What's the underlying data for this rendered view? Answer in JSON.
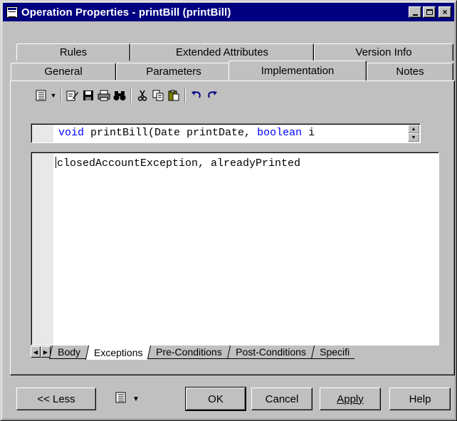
{
  "window": {
    "title": "Operation Properties - printBill (printBill)",
    "minimize": "_",
    "maximize": "□",
    "close": "×"
  },
  "tabs": {
    "row1": [
      "Rules",
      "Extended Attributes",
      "Version Info"
    ],
    "row2": [
      "General",
      "Parameters",
      "Implementation",
      "Notes"
    ],
    "active": "Implementation"
  },
  "toolbar": {
    "icons": [
      "properties-menu-icon",
      "dropdown-arrow-icon",
      "edit-icon",
      "save-icon",
      "print-icon",
      "find-icon",
      "cut-icon",
      "copy-icon",
      "paste-icon",
      "undo-icon",
      "redo-icon"
    ]
  },
  "signature": {
    "kw_void": "void",
    "text1": " printBill(Date printDate, ",
    "kw_boolean": "boolean",
    "text2": " i"
  },
  "editor": {
    "content": "closedAccountException, alreadyPrinted"
  },
  "subtabs": {
    "items": [
      "Body",
      "Exceptions",
      "Pre-Conditions",
      "Post-Conditions",
      "Specifi"
    ],
    "active": "Exceptions"
  },
  "buttons": {
    "less": "<< Less",
    "ok": "OK",
    "cancel": "Cancel",
    "apply": "Apply",
    "help": "Help"
  },
  "colors": {
    "titlebar": "#000080",
    "keyword": "#0000ff",
    "face": "#c0c0c0"
  }
}
